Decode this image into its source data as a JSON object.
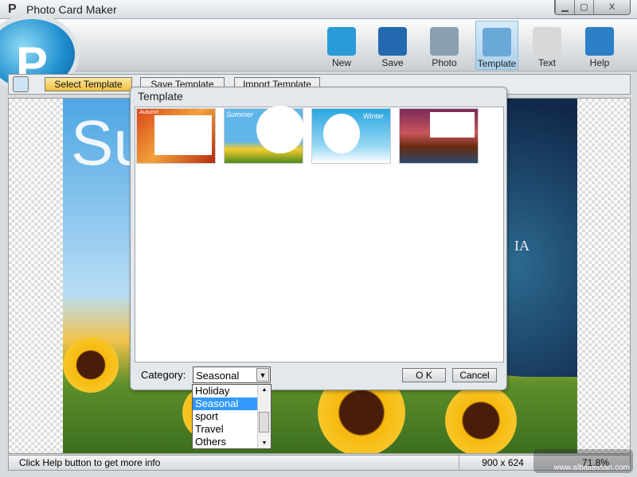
{
  "window": {
    "title": "Photo Card Maker",
    "logo": "P",
    "controls": [
      "minimize",
      "maximize",
      "close"
    ]
  },
  "toolbar": {
    "items": [
      {
        "label": "New",
        "icon": "folder-icon",
        "color": "#2a9ad8"
      },
      {
        "label": "Save",
        "icon": "save-icon",
        "color": "#2469b0"
      },
      {
        "label": "Photo",
        "icon": "photo-icon",
        "color": "#8aa0b0"
      },
      {
        "label": "Template",
        "icon": "template-icon",
        "color": "#6aa8d8",
        "active": true
      },
      {
        "label": "Text",
        "icon": "text-icon",
        "color": "#d8d8d8"
      },
      {
        "label": "Help",
        "icon": "help-icon",
        "color": "#2d7fc8"
      }
    ]
  },
  "subtoolbar": {
    "select": "Select Template",
    "save": "Save Template",
    "import": "Import Template"
  },
  "canvas": {
    "text_left": "Su",
    "text_right": "IA"
  },
  "dialog": {
    "title": "Template",
    "templates": [
      {
        "name": "Autumn",
        "label": "Autumn"
      },
      {
        "name": "Summer",
        "label": "Summer"
      },
      {
        "name": "Winter",
        "label": "Winter"
      },
      {
        "name": "Sunset",
        "label": ""
      }
    ],
    "category_label": "Category:",
    "category_value": "Seasonal",
    "ok": "O K",
    "cancel": "Cancel",
    "options": [
      "Holiday",
      "Seasonal",
      "sport",
      "Travel",
      "Others"
    ],
    "selected_index": 1
  },
  "status": {
    "message": "Click Help button to get more info",
    "dimensions": "900 x 624",
    "zoom": "71.8%"
  },
  "watermark": "www.albailassan.com"
}
